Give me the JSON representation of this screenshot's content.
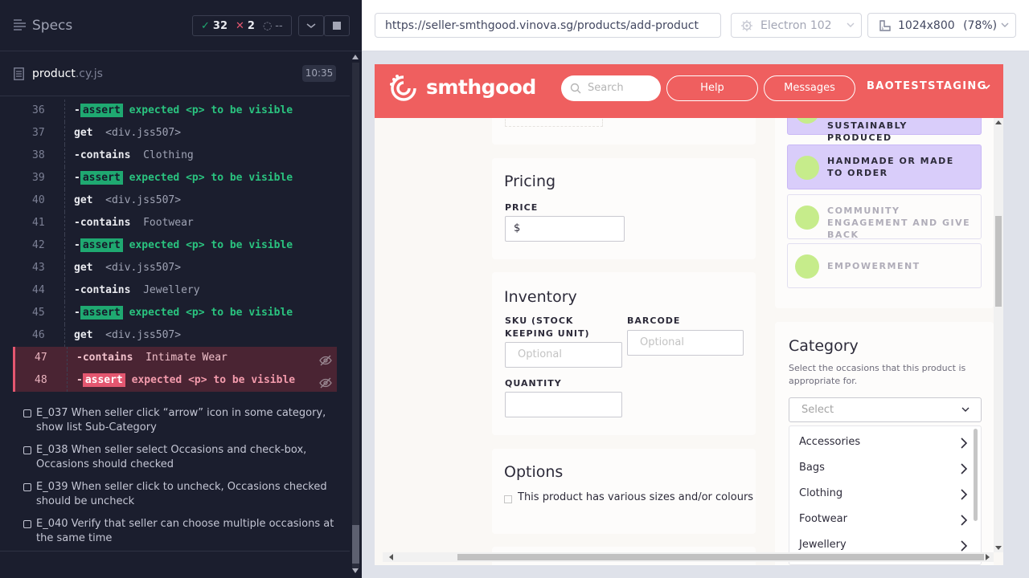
{
  "runner": {
    "specs_title": "Specs",
    "stats": {
      "passed": "32",
      "failed": "2",
      "pending": "--"
    },
    "file": {
      "name": "product",
      "ext": ".cy.js",
      "time": "10:35"
    },
    "commands": [
      {
        "line": "36",
        "kind": "assert",
        "name": "-",
        "tag": "assert",
        "text": "expected <p> to be visible"
      },
      {
        "line": "37",
        "kind": "cmd",
        "name": "get",
        "arg": "<div.jss507>"
      },
      {
        "line": "38",
        "kind": "cmd",
        "name": "-contains",
        "arg": "Clothing"
      },
      {
        "line": "39",
        "kind": "assert",
        "name": "-",
        "tag": "assert",
        "text": "expected <p> to be visible"
      },
      {
        "line": "40",
        "kind": "cmd",
        "name": "get",
        "arg": "<div.jss507>"
      },
      {
        "line": "41",
        "kind": "cmd",
        "name": "-contains",
        "arg": "Footwear"
      },
      {
        "line": "42",
        "kind": "assert",
        "name": "-",
        "tag": "assert",
        "text": "expected <p> to be visible"
      },
      {
        "line": "43",
        "kind": "cmd",
        "name": "get",
        "arg": "<div.jss507>"
      },
      {
        "line": "44",
        "kind": "cmd",
        "name": "-contains",
        "arg": "Jewellery"
      },
      {
        "line": "45",
        "kind": "assert",
        "name": "-",
        "tag": "assert",
        "text": "expected <p> to be visible"
      },
      {
        "line": "46",
        "kind": "cmd",
        "name": "get",
        "arg": "<div.jss507>"
      },
      {
        "line": "47",
        "kind": "cmd-failed",
        "name": "-contains",
        "arg": "Intimate Wear"
      },
      {
        "line": "48",
        "kind": "assert-failed",
        "name": "-",
        "tag": "assert",
        "text": "expected <p> to be visible"
      }
    ],
    "tests": [
      "E_037 When seller click “arrow” icon in some category, show list Sub-Category",
      "E_038 When seller select Occasions and check-box, Occasions should checked",
      "E_039 When seller click to uncheck, Occasions checked should be uncheck",
      "E_040 Verify that seller can choose multiple occasions at the same time"
    ]
  },
  "browser_bar": {
    "url": "https://seller-smthgood.vinova.sg/products/add-product",
    "browser": "Electron 102",
    "viewport": "1024x800",
    "zoom": "(78%)"
  },
  "app": {
    "logo": "smthgood",
    "search_placeholder": "Search",
    "help": "Help",
    "messages": "Messages",
    "user": "BAOTESTSTAGING",
    "pricing": {
      "title": "Pricing",
      "price_label": "PRICE",
      "price_value": "$"
    },
    "inventory": {
      "title": "Inventory",
      "sku_label": "SKU (STOCK KEEPING UNIT)",
      "sku_placeholder": "Optional",
      "barcode_label": "BARCODE",
      "barcode_placeholder": "Optional",
      "quantity_label": "QUANTITY"
    },
    "options": {
      "title": "Options",
      "checkbox_label": "This product has various sizes and/or colours"
    },
    "values": [
      {
        "label": "SUSTAINABLY PRODUCED",
        "selected": true
      },
      {
        "label": "HANDMADE OR MADE TO ORDER",
        "selected": true
      },
      {
        "label": "COMMUNITY ENGAGEMENT AND GIVE BACK",
        "selected": false
      },
      {
        "label": "EMPOWERMENT",
        "selected": false
      }
    ],
    "category": {
      "title": "Category",
      "description": "Select the occasions that this product is appropriate for.",
      "select_placeholder": "Select",
      "items": [
        "Accessories",
        "Bags",
        "Clothing",
        "Footwear",
        "Jewellery"
      ]
    }
  },
  "colors": {
    "brand": "#ef5f5f",
    "pass": "#1fa971",
    "fail": "#e45770",
    "value_selected": "#d9cdfa"
  }
}
